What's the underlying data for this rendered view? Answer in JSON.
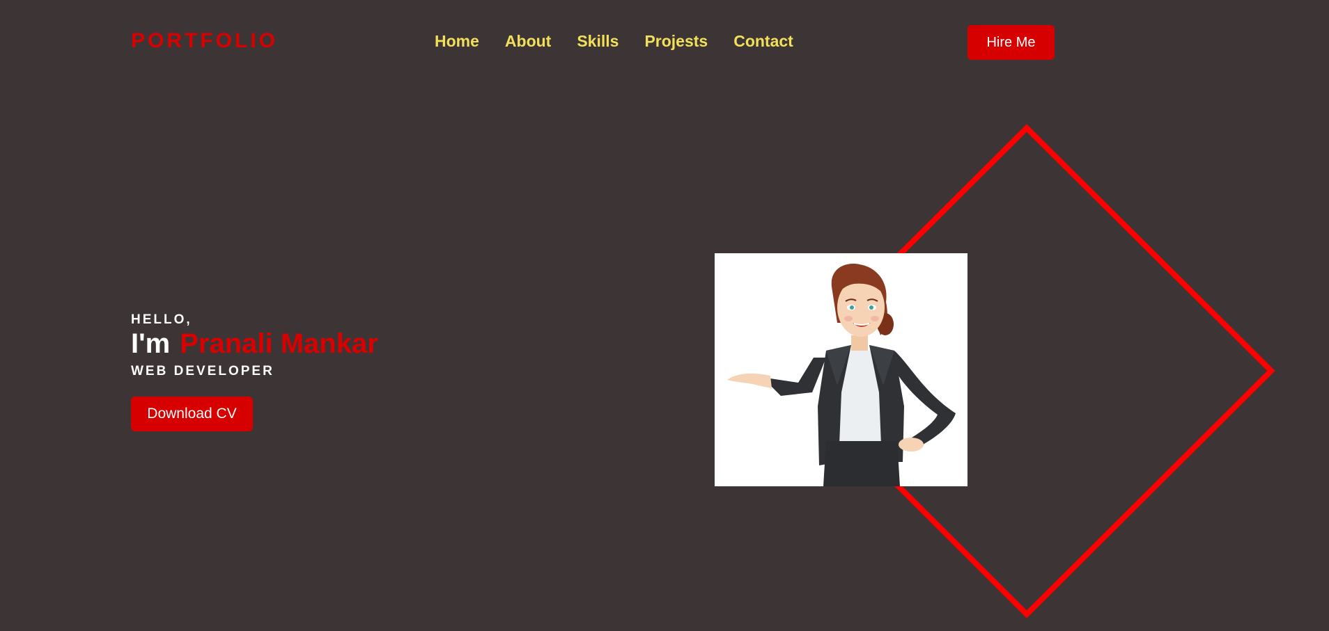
{
  "header": {
    "logo": "PORTFOLIO",
    "nav": [
      "Home",
      "About",
      "Skills",
      "Projests",
      "Contact"
    ],
    "hire_label": "Hire Me"
  },
  "hero": {
    "greeting": "HELLO,",
    "intro_prefix": "I'm",
    "name": "Pranali Mankar",
    "role": "WEB DEVELOPER",
    "cv_label": "Download CV"
  },
  "colors": {
    "background": "#3d3436",
    "accent": "#d60000",
    "nav_text": "#f3e05a",
    "diamond": "#ff0000"
  },
  "icons": {
    "avatar": "businesswoman-illustration"
  }
}
